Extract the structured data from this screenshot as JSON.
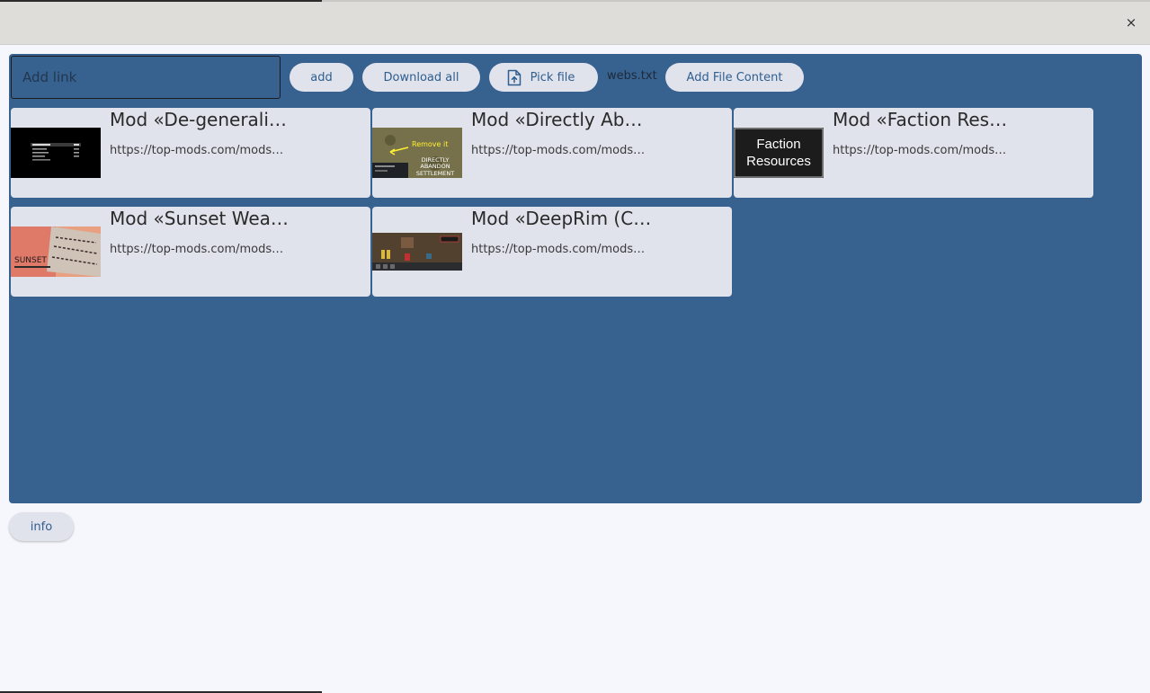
{
  "window": {
    "close_symbol": "×"
  },
  "toolbar": {
    "link_placeholder": "Add link",
    "add_label": "add",
    "download_all_label": "Download all",
    "pick_file_label": "Pick file",
    "pick_file_icon": "file-upload-icon",
    "filename": "webs.txt",
    "add_file_content_label": "Add File Content"
  },
  "mods": [
    {
      "title": "Mod «De-generali…",
      "url": "https://top-mods.com/mods…",
      "thumb": "de-generalize-thumbnail"
    },
    {
      "title": "Mod «Directly Ab…",
      "url": "https://top-mods.com/mods…",
      "thumb": "directly-abandon-thumbnail",
      "thumb_text": [
        "Remove it",
        "DIRECTLY",
        "ABANDON",
        "SETTLEMENT"
      ]
    },
    {
      "title": "Mod «Faction Res…",
      "url": "https://top-mods.com/mods…",
      "thumb": "faction-resources-thumbnail",
      "thumb_text": [
        "Faction",
        "Resources"
      ]
    },
    {
      "title": "Mod «Sunset Wea…",
      "url": "https://top-mods.com/mods…",
      "thumb": "sunset-weapons-thumbnail",
      "thumb_text": [
        "SUNSET"
      ]
    },
    {
      "title": "Mod «DeepRim (C…",
      "url": "https://top-mods.com/mods…",
      "thumb": "deeprim-thumbnail"
    }
  ],
  "footer": {
    "info_label": "info"
  },
  "colors": {
    "panel_bg": "#37618f",
    "card_bg": "#e0e2ec",
    "button_text": "#2f5f8f",
    "titlebar_bg": "#deddda",
    "page_bg": "#f6f7fc"
  }
}
